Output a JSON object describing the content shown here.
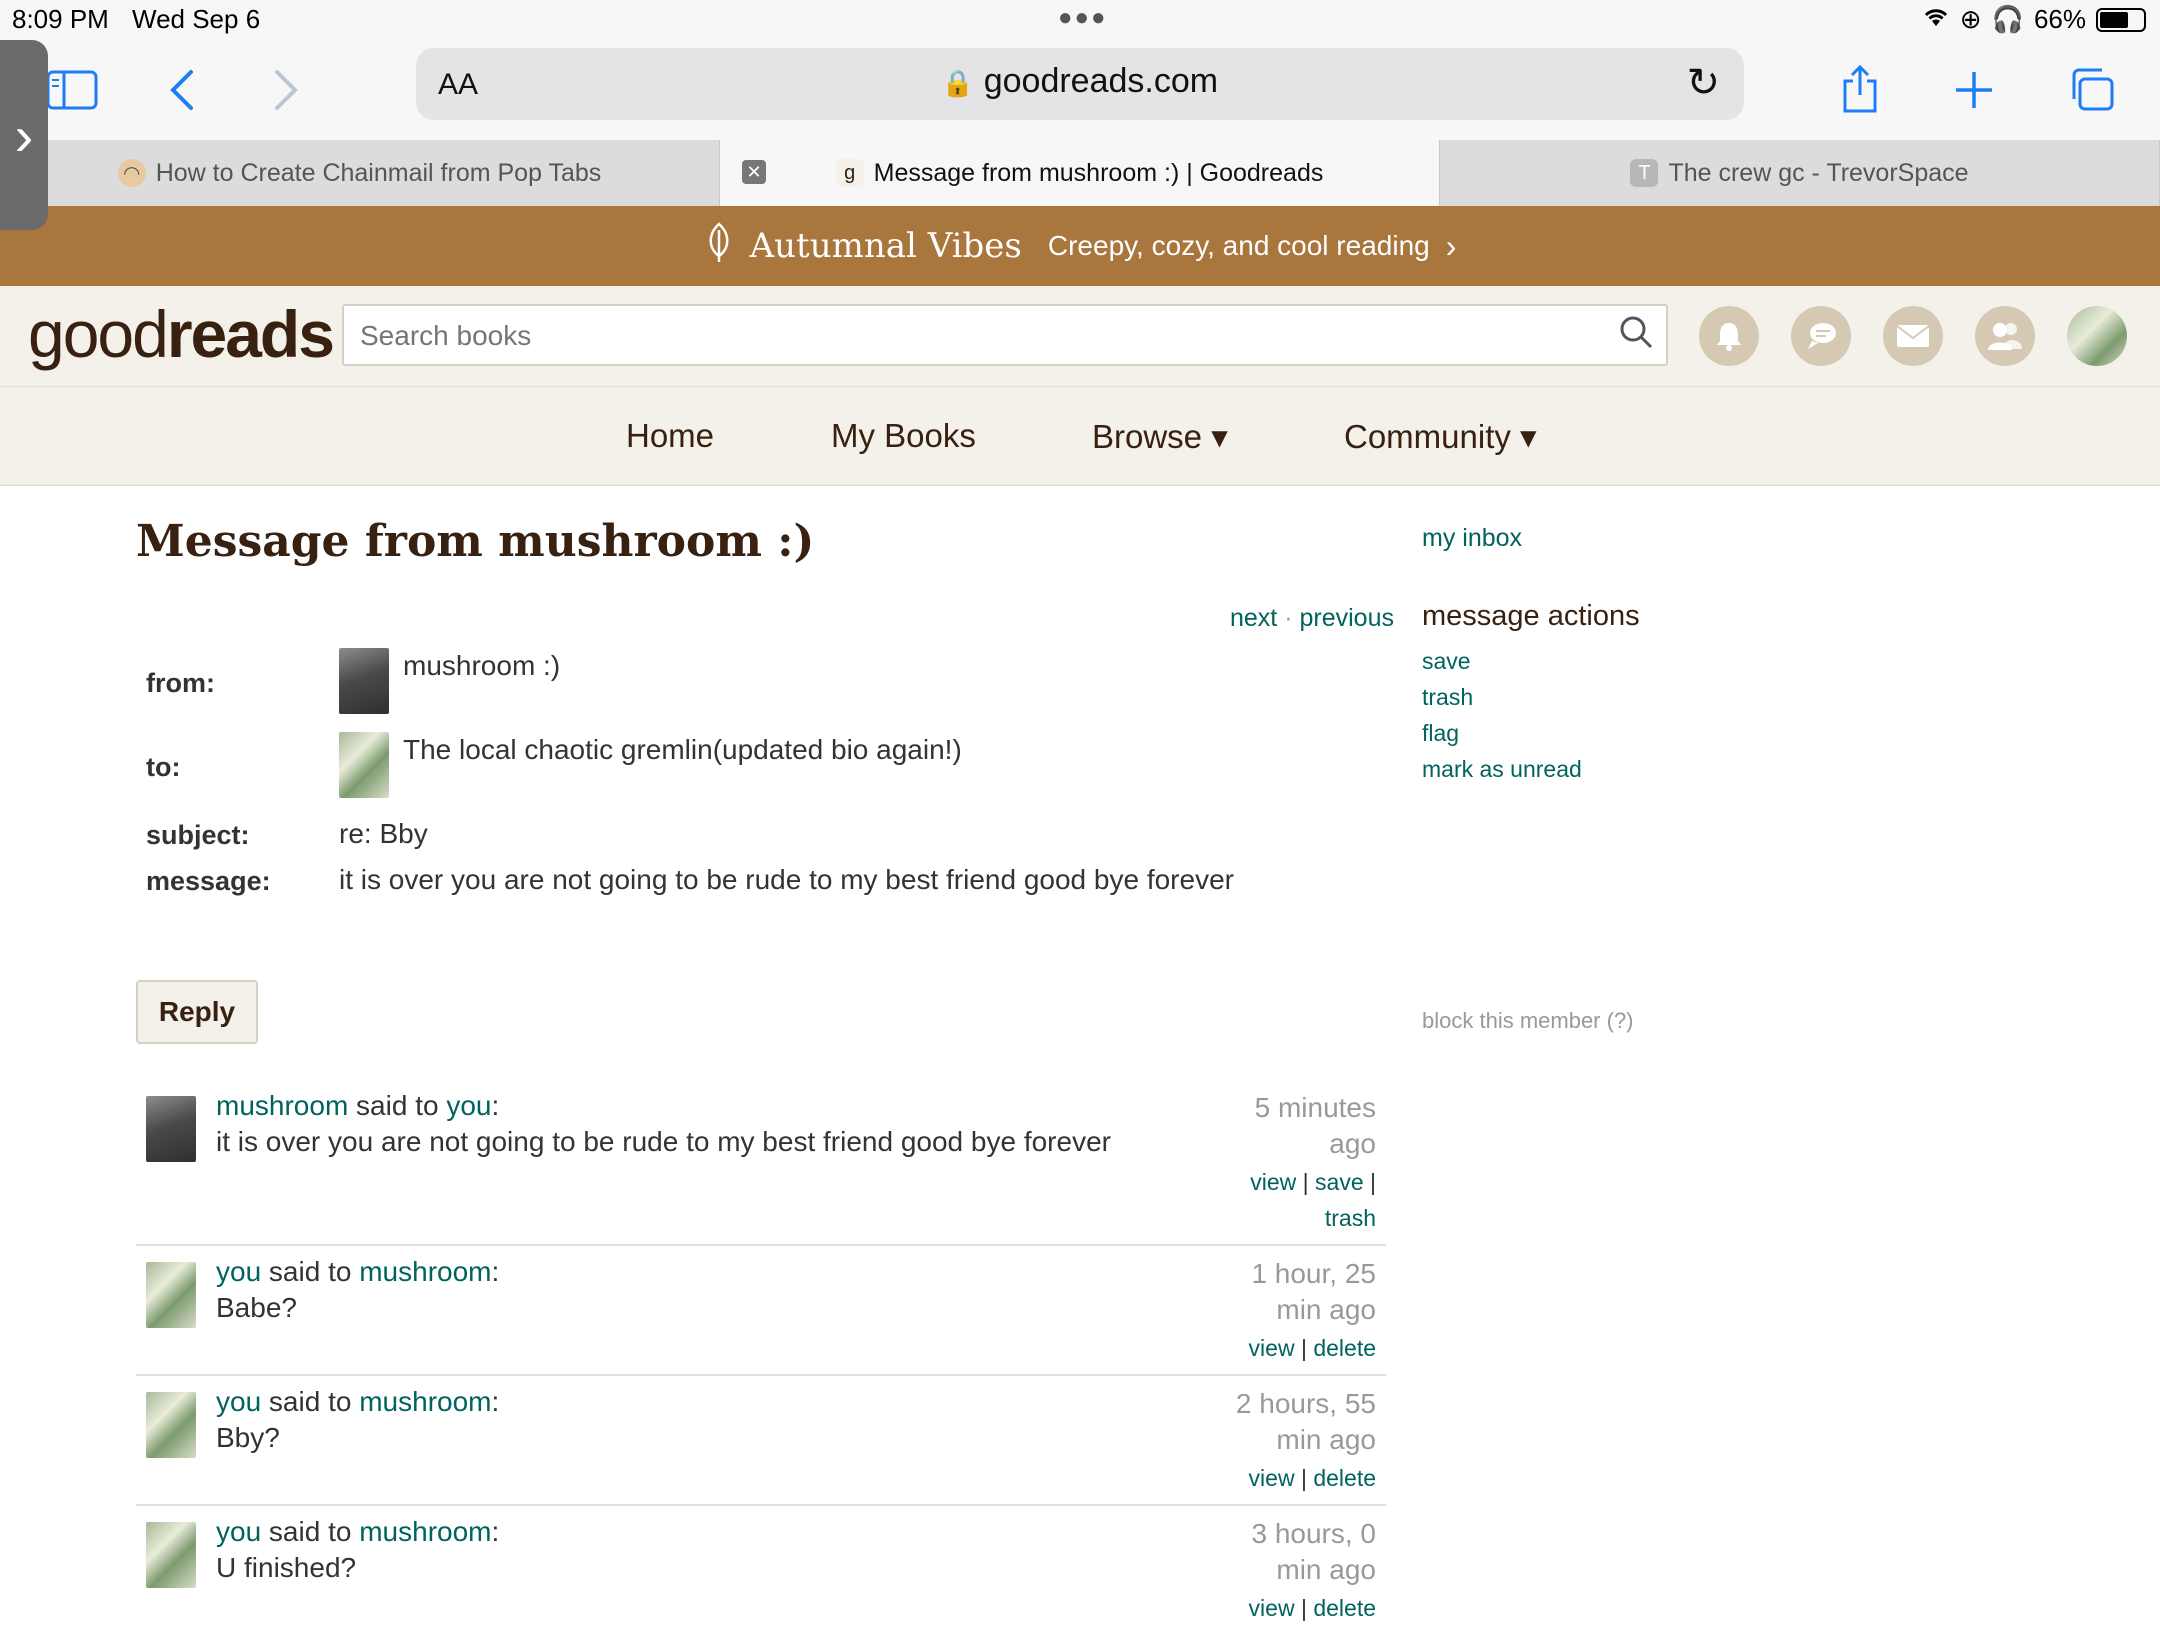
{
  "status_bar": {
    "time": "8:09 PM",
    "date": "Wed Sep 6",
    "battery": "66%",
    "battery_level": 0.66
  },
  "browser": {
    "url": "goodreads.com",
    "text_size_label": "AA",
    "tabs": [
      {
        "title": "How to Create Chainmail from Pop Tabs",
        "active": false
      },
      {
        "title": "Message from mushroom :) | Goodreads",
        "active": true,
        "favicon": "g"
      },
      {
        "title": "The crew gc - TrevorSpace",
        "active": false,
        "favicon": "T"
      }
    ]
  },
  "banner": {
    "title": "Autumnal Vibes",
    "subtitle": "Creepy, cozy, and cool reading"
  },
  "header": {
    "logo_light": "good",
    "logo_bold": "reads",
    "search_placeholder": "Search books"
  },
  "nav": {
    "home": "Home",
    "my_books": "My Books",
    "browse": "Browse ▾",
    "community": "Community ▾"
  },
  "message": {
    "title": "Message from mushroom :)",
    "next": "next",
    "nav_sep": " · ",
    "previous": "previous",
    "from_label": "from:",
    "from_name": "mushroom :)",
    "to_label": "to:",
    "to_name": "The local chaotic gremlin(updated bio again!)",
    "subject_label": "subject:",
    "subject": "re: Bby",
    "message_label": "message:",
    "body": "it is over you are not going to be rude to my best friend good bye forever",
    "reply_label": "Reply"
  },
  "sidebar": {
    "inbox": "my inbox",
    "actions_heading": "message actions",
    "save": "save",
    "trash": "trash",
    "flag": "flag",
    "mark_unread": "mark as unread",
    "block": "block this member (?)"
  },
  "thread": [
    {
      "speaker": "mushroom",
      "said_to": " said to ",
      "listener": "you",
      "colon": ":",
      "body": "it is over you are not going to be rude to my best friend good bye forever",
      "time_line1": "5 minutes",
      "time_line2": "ago",
      "action1": "view",
      "action2": "save",
      "action3": "trash"
    },
    {
      "speaker": "you",
      "said_to": " said to ",
      "listener": "mushroom",
      "colon": ":",
      "body": "Babe?",
      "time_line1": "1 hour, 25",
      "time_line2": "min ago",
      "action1": "view",
      "action2": "delete"
    },
    {
      "speaker": "you",
      "said_to": " said to ",
      "listener": "mushroom",
      "colon": ":",
      "body": "Bby?",
      "time_line1": "2 hours, 55",
      "time_line2": "min ago",
      "action1": "view",
      "action2": "delete"
    },
    {
      "speaker": "you",
      "said_to": " said to ",
      "listener": "mushroom",
      "colon": ":",
      "body": "U finished?",
      "time_line1": "3 hours, 0",
      "time_line2": "min ago",
      "action1": "view",
      "action2": "delete"
    }
  ],
  "colors": {
    "banner": "#a9763e",
    "link": "#00635d",
    "brown": "#382110",
    "header_bg": "#f4f1ea",
    "ios_blue": "#1d7df4"
  }
}
